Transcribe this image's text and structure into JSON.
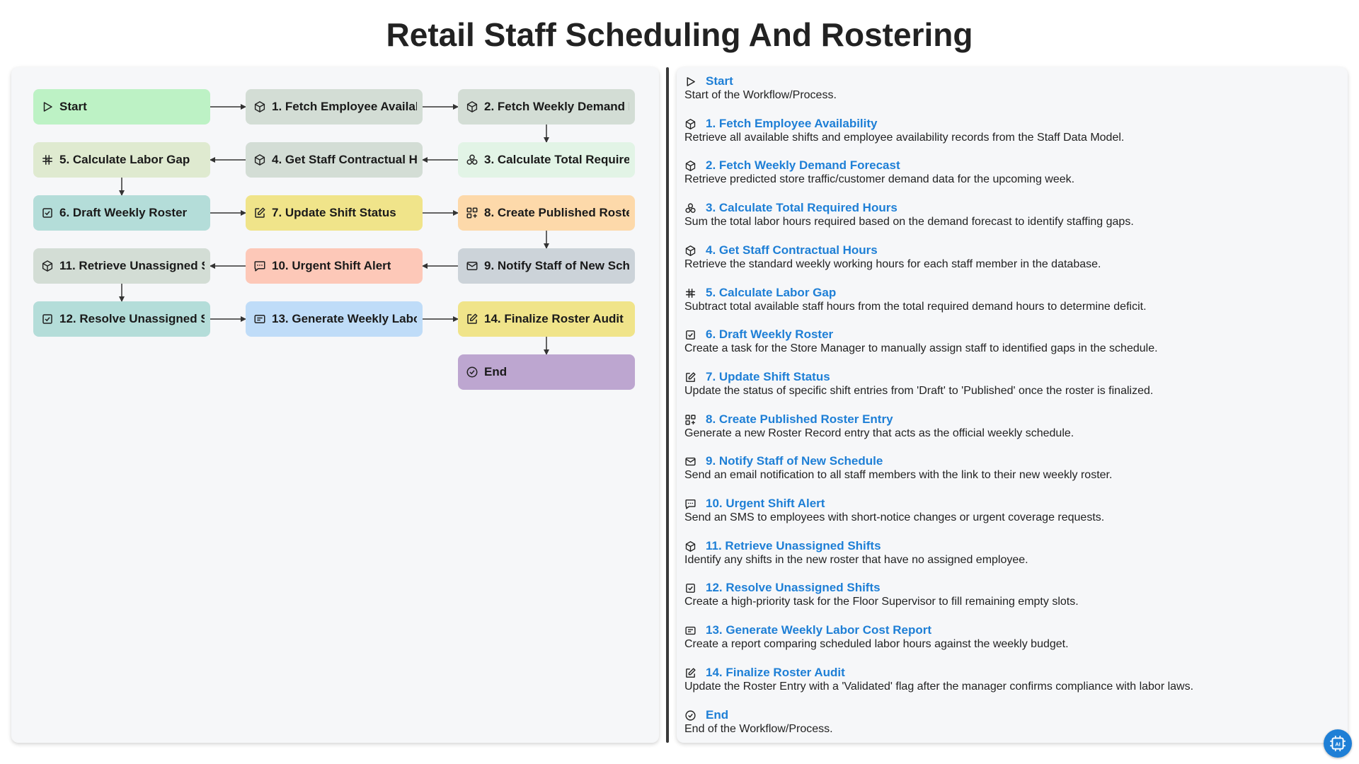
{
  "title": "Retail Staff Scheduling And Rostering",
  "colors": {
    "green": "#bdf2c5",
    "grey_green": "#d3ddd5",
    "mint": "#e2f4e6",
    "olive": "#dfead0",
    "teal": "#b4ddd9",
    "yellow": "#f0e48a",
    "peach": "#fdd9aa",
    "slate": "#ccd3d9",
    "salmon": "#fdc8b8",
    "blue": "#bfdcf8",
    "purple": "#bda6d0",
    "link": "#1e7fd6"
  },
  "nodes": [
    {
      "id": "start",
      "label": "Start",
      "icon": "play-icon",
      "color": "#bdf2c5"
    },
    {
      "id": "n1",
      "label": "1. Fetch Employee Availability",
      "icon": "cube-icon",
      "color": "#d3ddd5"
    },
    {
      "id": "n2",
      "label": "2. Fetch Weekly Demand Forecast",
      "icon": "cube-icon",
      "color": "#d3ddd5"
    },
    {
      "id": "n3",
      "label": "3. Calculate Total Required Hours",
      "icon": "sum-icon",
      "color": "#e2f4e6"
    },
    {
      "id": "n4",
      "label": "4. Get Staff Contractual Hours",
      "icon": "cube-icon",
      "color": "#d3ddd5"
    },
    {
      "id": "n5",
      "label": "5. Calculate Labor Gap",
      "icon": "hash-icon",
      "color": "#dfead0"
    },
    {
      "id": "n6",
      "label": "6. Draft Weekly Roster",
      "icon": "checkbox-icon",
      "color": "#b4ddd9"
    },
    {
      "id": "n7",
      "label": "7. Update Shift Status",
      "icon": "edit-icon",
      "color": "#f0e48a"
    },
    {
      "id": "n8",
      "label": "8. Create Published Roster Entry",
      "icon": "grid-plus-icon",
      "color": "#fdd9aa"
    },
    {
      "id": "n9",
      "label": "9. Notify Staff of New Schedule",
      "icon": "mail-icon",
      "color": "#ccd3d9"
    },
    {
      "id": "n10",
      "label": "10. Urgent Shift Alert",
      "icon": "sms-icon",
      "color": "#fdc8b8"
    },
    {
      "id": "n11",
      "label": "11. Retrieve Unassigned Shifts",
      "icon": "cube-icon",
      "color": "#d3ddd5"
    },
    {
      "id": "n12",
      "label": "12. Resolve Unassigned Shifts",
      "icon": "checkbox-icon",
      "color": "#b4ddd9"
    },
    {
      "id": "n13",
      "label": "13. Generate Weekly Labor Cost Report",
      "icon": "report-icon",
      "color": "#bfdcf8"
    },
    {
      "id": "n14",
      "label": "14. Finalize Roster Audit",
      "icon": "edit-icon",
      "color": "#f0e48a"
    },
    {
      "id": "end",
      "label": "End",
      "icon": "check-circle-icon",
      "color": "#bda6d0"
    }
  ],
  "details": [
    {
      "title": "Start",
      "icon": "play-icon",
      "description": "Start of the Workflow/Process."
    },
    {
      "title": "1. Fetch Employee Availability",
      "icon": "cube-icon",
      "description": "Retrieve all available shifts and employee availability records from the Staff Data Model."
    },
    {
      "title": "2. Fetch Weekly Demand Forecast",
      "icon": "cube-icon",
      "description": "Retrieve predicted store traffic/customer demand data for the upcoming week."
    },
    {
      "title": "3. Calculate Total Required Hours",
      "icon": "sum-icon",
      "description": "Sum the total labor hours required based on the demand forecast to identify staffing gaps."
    },
    {
      "title": "4. Get Staff Contractual Hours",
      "icon": "cube-icon",
      "description": "Retrieve the standard weekly working hours for each staff member in the database."
    },
    {
      "title": "5. Calculate Labor Gap",
      "icon": "hash-icon",
      "description": "Subtract total available staff hours from the total required demand hours to determine deficit."
    },
    {
      "title": "6. Draft Weekly Roster",
      "icon": "checkbox-icon",
      "description": "Create a task for the Store Manager to manually assign staff to identified gaps in the schedule."
    },
    {
      "title": "7. Update Shift Status",
      "icon": "edit-icon",
      "description": "Update the status of specific shift entries from 'Draft' to 'Published' once the roster is finalized."
    },
    {
      "title": "8. Create Published Roster Entry",
      "icon": "grid-plus-icon",
      "description": "Generate a new Roster Record entry that acts as the official weekly schedule."
    },
    {
      "title": "9. Notify Staff of New Schedule",
      "icon": "mail-icon",
      "description": "Send an email notification to all staff members with the link to their new weekly roster."
    },
    {
      "title": "10. Urgent Shift Alert",
      "icon": "sms-icon",
      "description": "Send an SMS to employees with short-notice changes or urgent coverage requests."
    },
    {
      "title": "11. Retrieve Unassigned Shifts",
      "icon": "cube-icon",
      "description": "Identify any shifts in the new roster that have no assigned employee."
    },
    {
      "title": "12. Resolve Unassigned Shifts",
      "icon": "checkbox-icon",
      "description": "Create a high-priority task for the Floor Supervisor to fill remaining empty slots."
    },
    {
      "title": "13. Generate Weekly Labor Cost Report",
      "icon": "report-icon",
      "description": "Create a report comparing scheduled labor hours against the weekly budget."
    },
    {
      "title": "14. Finalize Roster Audit",
      "icon": "edit-icon",
      "description": "Update the Roster Entry with a 'Validated' flag after the manager confirms compliance with labor laws."
    },
    {
      "title": "End",
      "icon": "check-circle-icon",
      "description": "End of the Workflow/Process."
    }
  ]
}
